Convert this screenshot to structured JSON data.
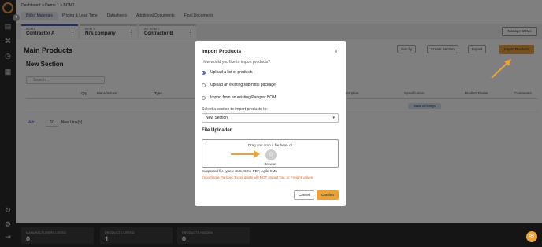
{
  "breadcrumb": {
    "items": [
      "Dashboard",
      "Demo 1",
      "BOM1"
    ],
    "sep": ">"
  },
  "tabs": [
    "Bill of Materials",
    "Pricing & Lead Time",
    "Datasheets",
    "Additional Documents",
    "Final Documents"
  ],
  "boms": [
    {
      "key": "BOM1",
      "name": "Contractor A"
    },
    {
      "key": "BOM 2",
      "name": "Ni's company"
    },
    {
      "key": "Alt. BOM 2",
      "name": "Contractor B"
    }
  ],
  "manage_boms": "Manage BOMs",
  "page_title": "Main Products",
  "toolbar": {
    "sort": "Sort by",
    "section": "Create Section",
    "export": "Export",
    "import": "Import Products"
  },
  "section_name": "New Section",
  "search_placeholder": "Search...",
  "table": {
    "headers": [
      "Qty",
      "Manufacturer",
      "Type",
      "Description",
      "Specification",
      "Product Finder",
      "Comments"
    ],
    "badge": "Basis of Design"
  },
  "add_row": {
    "label": "Add",
    "count": "10",
    "suffix": "New Line(s)"
  },
  "footer": [
    {
      "label": "MANUFACTURERS LISTED",
      "value": "0"
    },
    {
      "label": "PRODUCTS LISTED",
      "value": "1"
    },
    {
      "label": "PRODUCTS HIDDEN",
      "value": "0"
    }
  ],
  "modal": {
    "title": "Import Products",
    "question": "How would you like to import products?",
    "options": [
      "Upload a list of products",
      "Upload an existing submittal package",
      "Import from an existing Parspec BOM"
    ],
    "selected_index": 0,
    "section_label": "Select a section to import products to:",
    "section_value": "New Section",
    "file_uploader": "File Uploader",
    "drop_text": "Drag and drop a file here, or",
    "browse": "Browse",
    "supported": "Supported file types: XLS, CSV, PDF, Agile XML",
    "warning": "Importing a Parspec Excel quote will NOT import Tax, or Freight values",
    "cancel": "Cancel",
    "confirm": "Confirm"
  },
  "colors": {
    "accent": "#e8a33d",
    "primary": "#4b5cc4",
    "sidebar": "#2b2b2b",
    "warning": "#d9662b"
  }
}
